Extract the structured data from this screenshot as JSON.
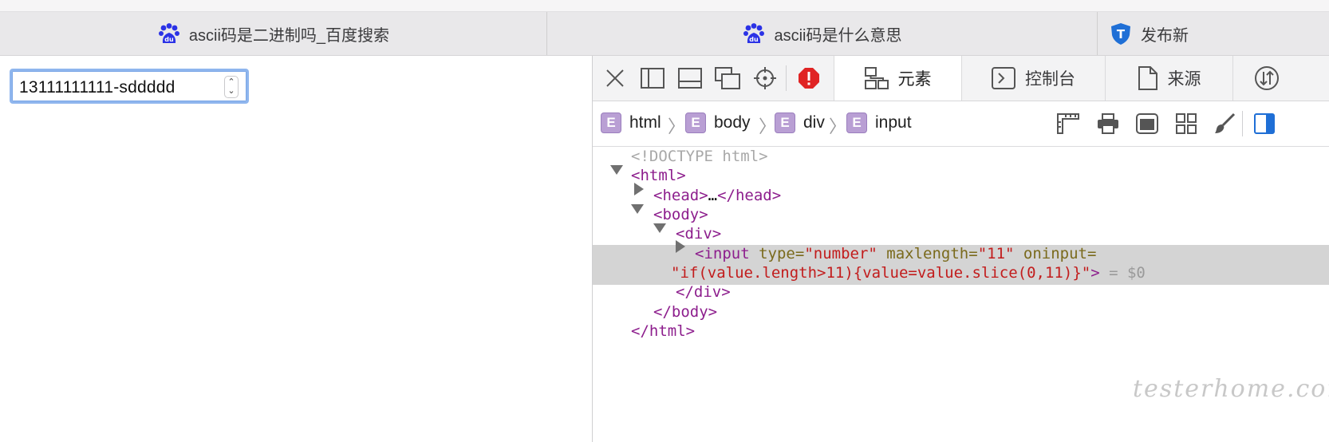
{
  "browser": {
    "tabs": [
      {
        "title": "ascii码是二进制吗_百度搜索",
        "icon": "baidu-paw-icon"
      },
      {
        "title": "ascii码是什么意思",
        "icon": "baidu-paw-icon"
      },
      {
        "title": "发布新",
        "icon": "shield-t-icon"
      }
    ]
  },
  "page": {
    "number_input": {
      "value": "13111111111-sddddd"
    }
  },
  "devtools": {
    "toolbar": {
      "icons": [
        "close-icon",
        "dock-left-icon",
        "dock-bottom-icon",
        "detach-window-icon",
        "inspect-crosshair-icon",
        "error-badge-icon"
      ],
      "tabs": [
        {
          "label": "元素",
          "icon": "elements-icon",
          "active": true
        },
        {
          "label": "控制台",
          "icon": "console-icon",
          "active": false
        },
        {
          "label": "来源",
          "icon": "sources-icon",
          "active": false
        }
      ]
    },
    "breadcrumb": [
      {
        "badge": "E",
        "label": "html"
      },
      {
        "badge": "E",
        "label": "body"
      },
      {
        "badge": "E",
        "label": "div"
      },
      {
        "badge": "E",
        "label": "input"
      }
    ],
    "dom": {
      "doctype": "<!DOCTYPE html>",
      "html_open": "<html>",
      "head": "<head>",
      "head_ellipsis": "…",
      "head_close": "</head>",
      "body_open": "<body>",
      "div_open": "<div>",
      "input_tag": "<input",
      "attr_type": "type",
      "val_type": "\"number\"",
      "attr_maxlength": "maxlength",
      "val_maxlength": "\"11\"",
      "attr_oninput": "oninput",
      "eq": "=",
      "val_oninput": "\"if(value.length>11){value=value.slice(0,11)}\"",
      "gt": ">",
      "selected_marker": "= $0",
      "div_close": "</div>",
      "body_close": "</body>",
      "html_close": "</html>"
    }
  },
  "watermark": "testerhome.com",
  "colors": {
    "accent": "#1f6fd6",
    "tag": "#8d1e8d",
    "attr": "#7a6a1c",
    "value": "#c21c1c",
    "badge": "#b99fd4",
    "error": "#e02424"
  }
}
